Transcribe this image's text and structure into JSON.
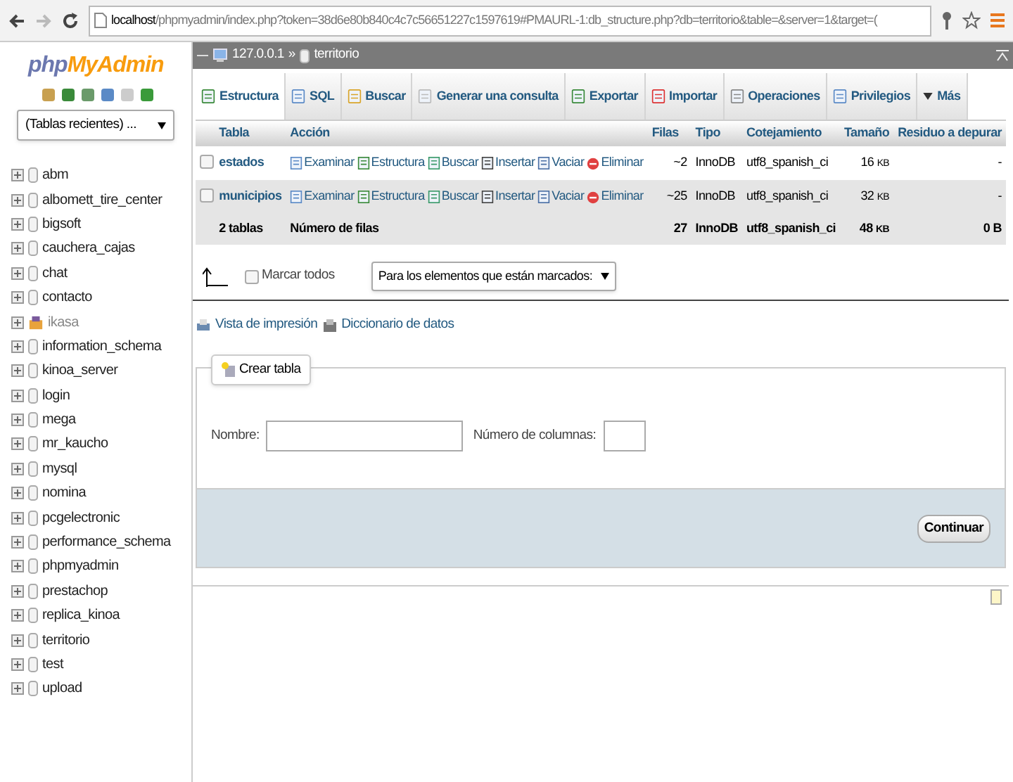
{
  "browser": {
    "url_host": "localhost",
    "url_rest": "/phpmyadmin/index.php?token=38d6e80b840c4c7c56651227c1597619#PMAURL-1:db_structure.php?db=territorio&table=&server=1&target=("
  },
  "sidebar": {
    "logo_php": "php",
    "logo_name": "MyAdmin",
    "recent": "(Tablas recientes) ...",
    "databases": [
      {
        "name": "abm",
        "kind": "db"
      },
      {
        "name": "albomett_tire_center",
        "kind": "db"
      },
      {
        "name": "bigsoft",
        "kind": "db"
      },
      {
        "name": "cauchera_cajas",
        "kind": "db"
      },
      {
        "name": "chat",
        "kind": "db"
      },
      {
        "name": "contacto",
        "kind": "db"
      },
      {
        "name": "ikasa",
        "kind": "special"
      },
      {
        "name": "information_schema",
        "kind": "db"
      },
      {
        "name": "kinoa_server",
        "kind": "db"
      },
      {
        "name": "login",
        "kind": "db"
      },
      {
        "name": "mega",
        "kind": "db"
      },
      {
        "name": "mr_kaucho",
        "kind": "db"
      },
      {
        "name": "mysql",
        "kind": "db"
      },
      {
        "name": "nomina",
        "kind": "db"
      },
      {
        "name": "pcgelectronic",
        "kind": "db"
      },
      {
        "name": "performance_schema",
        "kind": "db"
      },
      {
        "name": "phpmyadmin",
        "kind": "db"
      },
      {
        "name": "prestachop",
        "kind": "db"
      },
      {
        "name": "replica_kinoa",
        "kind": "db"
      },
      {
        "name": "territorio",
        "kind": "db"
      },
      {
        "name": "test",
        "kind": "db"
      },
      {
        "name": "upload",
        "kind": "db"
      }
    ]
  },
  "breadcrumb": {
    "server": "127.0.0.1",
    "separator": "»",
    "database": "territorio"
  },
  "tabs": [
    {
      "label": "Estructura",
      "selected": true
    },
    {
      "label": "SQL",
      "selected": false
    },
    {
      "label": "Buscar",
      "selected": false
    },
    {
      "label": "Generar una consulta",
      "selected": false
    },
    {
      "label": "Exportar",
      "selected": false
    },
    {
      "label": "Importar",
      "selected": false
    },
    {
      "label": "Operaciones",
      "selected": false
    },
    {
      "label": "Privilegios",
      "selected": false
    },
    {
      "label": "Más",
      "selected": false
    }
  ],
  "table": {
    "columns": [
      "Tabla",
      "Acción",
      "Filas",
      "Tipo",
      "Cotejamiento",
      "Tamaño",
      "Residuo a depurar"
    ],
    "rows": [
      {
        "name": "estados",
        "checked": false,
        "actions": [
          "Examinar",
          "Estructura",
          "Buscar",
          "Insertar",
          "Vaciar",
          "Eliminar"
        ],
        "rows": "~2",
        "type": "InnoDB",
        "collation": "utf8_spanish_ci",
        "size": "16",
        "unit": "KB",
        "overhead": "-"
      },
      {
        "name": "municipios",
        "checked": false,
        "actions": [
          "Examinar",
          "Estructura",
          "Buscar",
          "Insertar",
          "Vaciar",
          "Eliminar"
        ],
        "rows": "~25",
        "type": "InnoDB",
        "collation": "utf8_spanish_ci",
        "size": "32",
        "unit": "KB",
        "overhead": "-"
      }
    ],
    "footer": {
      "name": "2 tablas",
      "label": "Número de filas",
      "rows": "27",
      "type": "InnoDB",
      "collation": "utf8_spanish_ci",
      "size": "48",
      "unit": "KB",
      "overhead": "0",
      "overhead_unit": "B"
    }
  },
  "bulk": {
    "check_all": "Marcar todos",
    "checked": false,
    "select": "Para los elementos que están marcados:"
  },
  "links": [
    "Vista de impresión",
    "Diccionario de datos"
  ],
  "create": {
    "legend": "Crear tabla",
    "name_label": "Nombre:",
    "columns_label": "Número de columnas:",
    "button": "Continuar"
  }
}
